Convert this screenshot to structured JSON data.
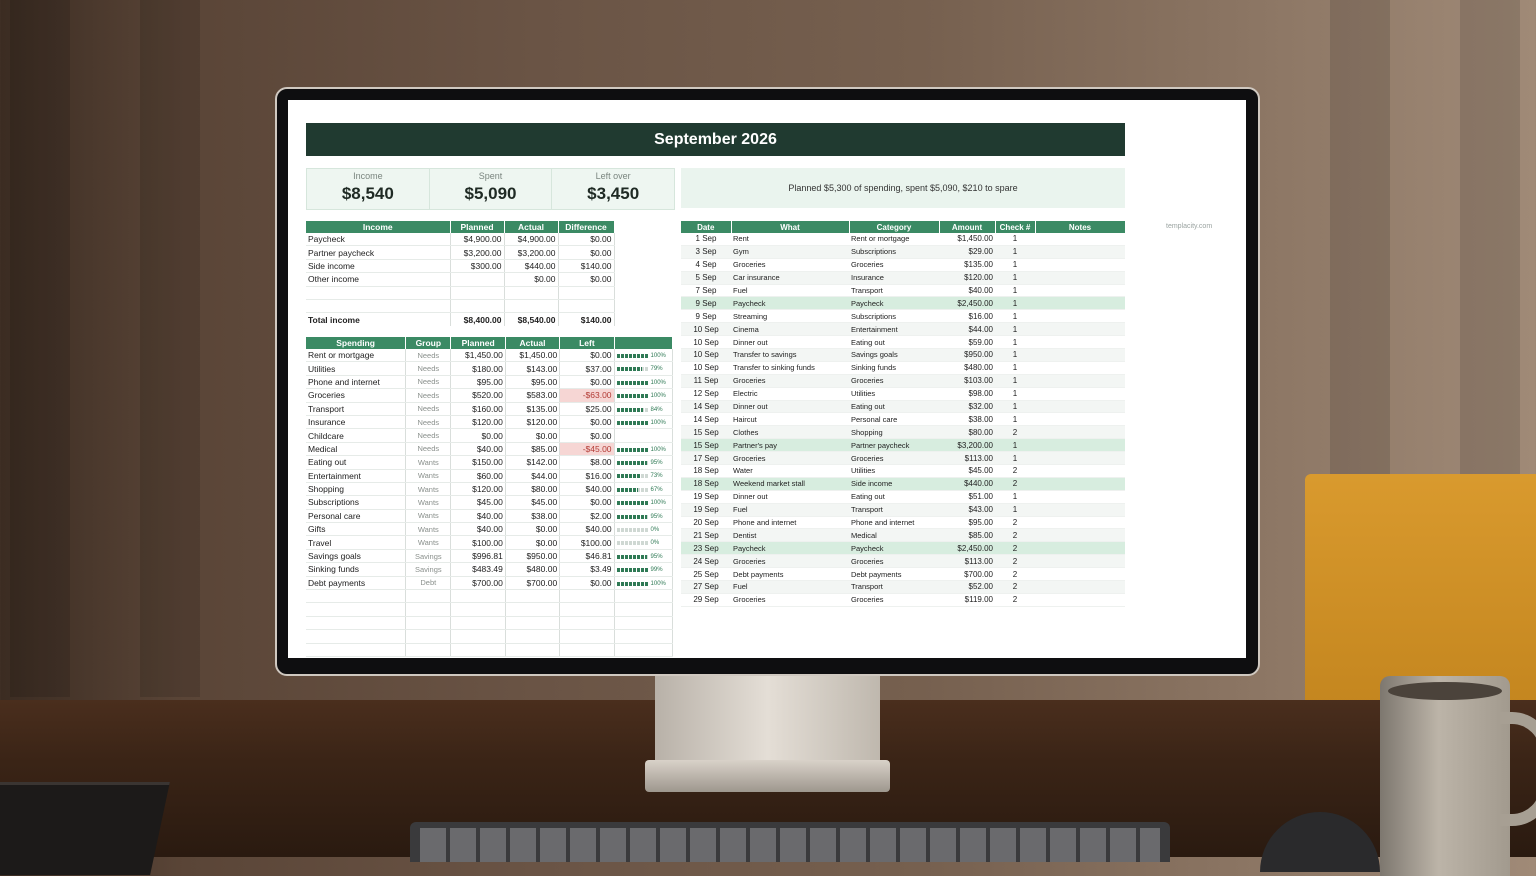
{
  "title": "September 2026",
  "summary": {
    "income_label": "Income",
    "income_value": "$8,540",
    "spent_label": "Spent",
    "spent_value": "$5,090",
    "leftover_label": "Left over",
    "leftover_value": "$3,450"
  },
  "plan_message": "Planned $5,300 of spending, spent $5,090, $210 to spare",
  "watermark": "templacity.com",
  "income_table": {
    "headers": [
      "Income",
      "Planned",
      "Actual",
      "Difference"
    ],
    "rows": [
      [
        "Paycheck",
        "$4,900.00",
        "$4,900.00",
        "$0.00"
      ],
      [
        "Partner paycheck",
        "$3,200.00",
        "$3,200.00",
        "$0.00"
      ],
      [
        "Side income",
        "$300.00",
        "$440.00",
        "$140.00"
      ],
      [
        "Other income",
        "",
        "$0.00",
        "$0.00"
      ],
      [
        "",
        "",
        "",
        ""
      ],
      [
        "",
        "",
        "",
        ""
      ]
    ],
    "total": [
      "Total income",
      "$8,400.00",
      "$8,540.00",
      "$140.00"
    ]
  },
  "spending_table": {
    "headers": [
      "Spending",
      "Group",
      "Planned",
      "Actual",
      "Left",
      ""
    ],
    "rows": [
      {
        "name": "Rent or mortgage",
        "group": "Needs",
        "planned": "$1,450.00",
        "actual": "$1,450.00",
        "left": "$0.00",
        "neg": false,
        "pct": "100%",
        "frac": 1.0
      },
      {
        "name": "Utilities",
        "group": "Needs",
        "planned": "$180.00",
        "actual": "$143.00",
        "left": "$37.00",
        "neg": false,
        "pct": "79%",
        "frac": 0.79
      },
      {
        "name": "Phone and internet",
        "group": "Needs",
        "planned": "$95.00",
        "actual": "$95.00",
        "left": "$0.00",
        "neg": false,
        "pct": "100%",
        "frac": 1.0
      },
      {
        "name": "Groceries",
        "group": "Needs",
        "planned": "$520.00",
        "actual": "$583.00",
        "left": "-$63.00",
        "neg": true,
        "pct": "100%",
        "frac": 1.0
      },
      {
        "name": "Transport",
        "group": "Needs",
        "planned": "$160.00",
        "actual": "$135.00",
        "left": "$25.00",
        "neg": false,
        "pct": "84%",
        "frac": 0.84
      },
      {
        "name": "Insurance",
        "group": "Needs",
        "planned": "$120.00",
        "actual": "$120.00",
        "left": "$0.00",
        "neg": false,
        "pct": "100%",
        "frac": 1.0
      },
      {
        "name": "Childcare",
        "group": "Needs",
        "planned": "$0.00",
        "actual": "$0.00",
        "left": "$0.00",
        "neg": false,
        "pct": "",
        "frac": -1
      },
      {
        "name": "Medical",
        "group": "Needs",
        "planned": "$40.00",
        "actual": "$85.00",
        "left": "-$45.00",
        "neg": true,
        "pct": "100%",
        "frac": 1.0
      },
      {
        "name": "Eating out",
        "group": "Wants",
        "planned": "$150.00",
        "actual": "$142.00",
        "left": "$8.00",
        "neg": false,
        "pct": "95%",
        "frac": 0.95
      },
      {
        "name": "Entertainment",
        "group": "Wants",
        "planned": "$60.00",
        "actual": "$44.00",
        "left": "$16.00",
        "neg": false,
        "pct": "73%",
        "frac": 0.73
      },
      {
        "name": "Shopping",
        "group": "Wants",
        "planned": "$120.00",
        "actual": "$80.00",
        "left": "$40.00",
        "neg": false,
        "pct": "67%",
        "frac": 0.67
      },
      {
        "name": "Subscriptions",
        "group": "Wants",
        "planned": "$45.00",
        "actual": "$45.00",
        "left": "$0.00",
        "neg": false,
        "pct": "100%",
        "frac": 1.0
      },
      {
        "name": "Personal care",
        "group": "Wants",
        "planned": "$40.00",
        "actual": "$38.00",
        "left": "$2.00",
        "neg": false,
        "pct": "95%",
        "frac": 0.95
      },
      {
        "name": "Gifts",
        "group": "Wants",
        "planned": "$40.00",
        "actual": "$0.00",
        "left": "$40.00",
        "neg": false,
        "pct": "0%",
        "frac": 0.0
      },
      {
        "name": "Travel",
        "group": "Wants",
        "planned": "$100.00",
        "actual": "$0.00",
        "left": "$100.00",
        "neg": false,
        "pct": "0%",
        "frac": 0.0
      },
      {
        "name": "Savings goals",
        "group": "Savings",
        "planned": "$996.81",
        "actual": "$950.00",
        "left": "$46.81",
        "neg": false,
        "pct": "95%",
        "frac": 0.95
      },
      {
        "name": "Sinking funds",
        "group": "Savings",
        "planned": "$483.49",
        "actual": "$480.00",
        "left": "$3.49",
        "neg": false,
        "pct": "99%",
        "frac": 0.99
      },
      {
        "name": "Debt payments",
        "group": "Debt",
        "planned": "$700.00",
        "actual": "$700.00",
        "left": "$0.00",
        "neg": false,
        "pct": "100%",
        "frac": 1.0
      }
    ]
  },
  "transactions": {
    "headers": [
      "Date",
      "What",
      "Category",
      "Amount",
      "Check #",
      "Notes"
    ],
    "rows": [
      {
        "date": "1 Sep",
        "what": "Rent",
        "category": "Rent or mortgage",
        "amount": "$1,450.00",
        "check": "1",
        "hl": false
      },
      {
        "date": "3 Sep",
        "what": "Gym",
        "category": "Subscriptions",
        "amount": "$29.00",
        "check": "1",
        "hl": false
      },
      {
        "date": "4 Sep",
        "what": "Groceries",
        "category": "Groceries",
        "amount": "$135.00",
        "check": "1",
        "hl": false
      },
      {
        "date": "5 Sep",
        "what": "Car insurance",
        "category": "Insurance",
        "amount": "$120.00",
        "check": "1",
        "hl": false
      },
      {
        "date": "7 Sep",
        "what": "Fuel",
        "category": "Transport",
        "amount": "$40.00",
        "check": "1",
        "hl": false
      },
      {
        "date": "9 Sep",
        "what": "Paycheck",
        "category": "Paycheck",
        "amount": "$2,450.00",
        "check": "1",
        "hl": true
      },
      {
        "date": "9 Sep",
        "what": "Streaming",
        "category": "Subscriptions",
        "amount": "$16.00",
        "check": "1",
        "hl": false
      },
      {
        "date": "10 Sep",
        "what": "Cinema",
        "category": "Entertainment",
        "amount": "$44.00",
        "check": "1",
        "hl": false
      },
      {
        "date": "10 Sep",
        "what": "Dinner out",
        "category": "Eating out",
        "amount": "$59.00",
        "check": "1",
        "hl": false
      },
      {
        "date": "10 Sep",
        "what": "Transfer to savings",
        "category": "Savings goals",
        "amount": "$950.00",
        "check": "1",
        "hl": false
      },
      {
        "date": "10 Sep",
        "what": "Transfer to sinking funds",
        "category": "Sinking funds",
        "amount": "$480.00",
        "check": "1",
        "hl": false
      },
      {
        "date": "11 Sep",
        "what": "Groceries",
        "category": "Groceries",
        "amount": "$103.00",
        "check": "1",
        "hl": false
      },
      {
        "date": "12 Sep",
        "what": "Electric",
        "category": "Utilities",
        "amount": "$98.00",
        "check": "1",
        "hl": false
      },
      {
        "date": "14 Sep",
        "what": "Dinner out",
        "category": "Eating out",
        "amount": "$32.00",
        "check": "1",
        "hl": false
      },
      {
        "date": "14 Sep",
        "what": "Haircut",
        "category": "Personal care",
        "amount": "$38.00",
        "check": "1",
        "hl": false
      },
      {
        "date": "15 Sep",
        "what": "Clothes",
        "category": "Shopping",
        "amount": "$80.00",
        "check": "2",
        "hl": false
      },
      {
        "date": "15 Sep",
        "what": "Partner's pay",
        "category": "Partner paycheck",
        "amount": "$3,200.00",
        "check": "1",
        "hl": true
      },
      {
        "date": "17 Sep",
        "what": "Groceries",
        "category": "Groceries",
        "amount": "$113.00",
        "check": "1",
        "hl": false
      },
      {
        "date": "18 Sep",
        "what": "Water",
        "category": "Utilities",
        "amount": "$45.00",
        "check": "2",
        "hl": false
      },
      {
        "date": "18 Sep",
        "what": "Weekend market stall",
        "category": "Side income",
        "amount": "$440.00",
        "check": "2",
        "hl": true
      },
      {
        "date": "19 Sep",
        "what": "Dinner out",
        "category": "Eating out",
        "amount": "$51.00",
        "check": "1",
        "hl": false
      },
      {
        "date": "19 Sep",
        "what": "Fuel",
        "category": "Transport",
        "amount": "$43.00",
        "check": "1",
        "hl": false
      },
      {
        "date": "20 Sep",
        "what": "Phone and internet",
        "category": "Phone and internet",
        "amount": "$95.00",
        "check": "2",
        "hl": false
      },
      {
        "date": "21 Sep",
        "what": "Dentist",
        "category": "Medical",
        "amount": "$85.00",
        "check": "2",
        "hl": false
      },
      {
        "date": "23 Sep",
        "what": "Paycheck",
        "category": "Paycheck",
        "amount": "$2,450.00",
        "check": "2",
        "hl": true
      },
      {
        "date": "24 Sep",
        "what": "Groceries",
        "category": "Groceries",
        "amount": "$113.00",
        "check": "2",
        "hl": false
      },
      {
        "date": "25 Sep",
        "what": "Debt payments",
        "category": "Debt payments",
        "amount": "$700.00",
        "check": "2",
        "hl": false
      },
      {
        "date": "27 Sep",
        "what": "Fuel",
        "category": "Transport",
        "amount": "$52.00",
        "check": "2",
        "hl": false
      },
      {
        "date": "29 Sep",
        "what": "Groceries",
        "category": "Groceries",
        "amount": "$119.00",
        "check": "2",
        "hl": false
      }
    ]
  },
  "colors": {
    "banner": "#203a30",
    "header": "#3b8a64",
    "highlight": "#d7eddf",
    "negative": "#f6d6d4"
  }
}
